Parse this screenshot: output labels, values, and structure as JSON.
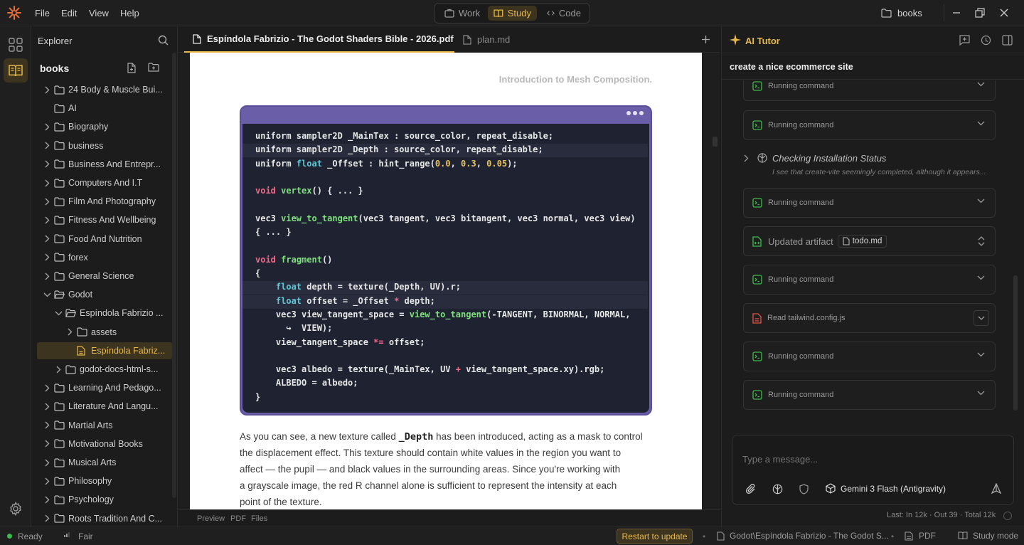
{
  "menu": [
    "File",
    "Edit",
    "View",
    "Help"
  ],
  "modes": [
    {
      "label": "Work",
      "icon": "briefcase-icon",
      "active": false
    },
    {
      "label": "Study",
      "icon": "book-open-icon",
      "active": true
    },
    {
      "label": "Code",
      "icon": "code-icon",
      "active": false
    }
  ],
  "workspace": "books",
  "explorer": {
    "title": "Explorer",
    "root": "books",
    "items": [
      {
        "label": "24 Body & Muscle Bui...",
        "depth": 0,
        "chevron": "right"
      },
      {
        "label": "AI",
        "depth": 0,
        "chevron": "none"
      },
      {
        "label": "Biography",
        "depth": 0,
        "chevron": "right"
      },
      {
        "label": "business",
        "depth": 0,
        "chevron": "right"
      },
      {
        "label": "Business And Entrepr...",
        "depth": 0,
        "chevron": "right"
      },
      {
        "label": "Computers And I.T",
        "depth": 0,
        "chevron": "right"
      },
      {
        "label": "Film And Photography",
        "depth": 0,
        "chevron": "right"
      },
      {
        "label": "Fitness And Wellbeing",
        "depth": 0,
        "chevron": "right"
      },
      {
        "label": "Food And Nutrition",
        "depth": 0,
        "chevron": "right"
      },
      {
        "label": "forex",
        "depth": 0,
        "chevron": "right"
      },
      {
        "label": "General Science",
        "depth": 0,
        "chevron": "right"
      },
      {
        "label": "Godot",
        "depth": 0,
        "chevron": "down"
      },
      {
        "label": "Espíndola Fabrizio ...",
        "depth": 1,
        "chevron": "down"
      },
      {
        "label": "assets",
        "depth": 2,
        "chevron": "right"
      },
      {
        "label": "Espíndola Fabriz...",
        "depth": 2,
        "chevron": "none",
        "file": true,
        "selected": true
      },
      {
        "label": "godot-docs-html-s...",
        "depth": 1,
        "chevron": "right"
      },
      {
        "label": "Learning And Pedago...",
        "depth": 0,
        "chevron": "right"
      },
      {
        "label": "Literature And Langu...",
        "depth": 0,
        "chevron": "right"
      },
      {
        "label": "Martial Arts",
        "depth": 0,
        "chevron": "right"
      },
      {
        "label": "Motivational Books",
        "depth": 0,
        "chevron": "right"
      },
      {
        "label": "Musical Arts",
        "depth": 0,
        "chevron": "right"
      },
      {
        "label": "Philosophy",
        "depth": 0,
        "chevron": "right"
      },
      {
        "label": "Psychology",
        "depth": 0,
        "chevron": "right"
      },
      {
        "label": "Roots Tradition And C...",
        "depth": 0,
        "chevron": "right"
      }
    ]
  },
  "tabs": [
    {
      "label": "Espíndola Fabrizio - The Godot Shaders Bible - 2026.pdf",
      "active": true
    },
    {
      "label": "plan.md",
      "active": false
    }
  ],
  "pdf": {
    "heading": "Introduction to Mesh Composition.",
    "code_lines": [
      {
        "text": "uniform sampler2D _MainTex : source_color, repeat_disable;",
        "hl": false
      },
      {
        "text": "uniform sampler2D _Depth : source_color, repeat_disable;",
        "hl": true
      },
      {
        "text": "uniform float _Offset : hint_range(0.0, 0.3, 0.05);",
        "hl": false
      },
      {
        "text": "",
        "hl": false
      },
      {
        "text": "void vertex() { ... }",
        "hl": false
      },
      {
        "text": "",
        "hl": false
      },
      {
        "text": "vec3 view_to_tangent(vec3 tangent, vec3 bitangent, vec3 normal, vec3 view)",
        "hl": false
      },
      {
        "text": "{ ... }",
        "hl": false
      },
      {
        "text": "",
        "hl": false
      },
      {
        "text": "void fragment()",
        "hl": false
      },
      {
        "text": "{",
        "hl": false
      },
      {
        "text": "    float depth = texture(_Depth, UV).r;",
        "hl": true
      },
      {
        "text": "    float offset = _Offset * depth;",
        "hl": true
      },
      {
        "text": "    vec3 view_tangent_space = view_to_tangent(-TANGENT, BINORMAL, NORMAL,",
        "hl": false
      },
      {
        "text": "      ↪  VIEW);",
        "hl": false
      },
      {
        "text": "    view_tangent_space *= offset;",
        "hl": false
      },
      {
        "text": "",
        "hl": false
      },
      {
        "text": "    vec3 albedo = texture(_MainTex, UV + view_tangent_space.xy).rgb;",
        "hl": false
      },
      {
        "text": "    ALBEDO = albedo;",
        "hl": false
      },
      {
        "text": "}",
        "hl": false
      }
    ],
    "prose_lines": [
      "As you can see, a new texture called _Depth has been introduced, acting as a mask to control",
      "the displacement effect. This texture should contain white values in the region you want to",
      "affect — the pupil — and black values in the surrounding areas. Since you're working with",
      "a grayscale image, the red R channel alone is sufficient to represent the intensity at each",
      "point of the texture."
    ]
  },
  "editor_footer": [
    "Preview",
    "PDF",
    "Files"
  ],
  "tutor": {
    "title": "AI Tutor",
    "prompt": "create a nice ecommerce site",
    "thinking_title": "Checking Installation Status",
    "thinking_sub": "I see that create-vite seemingly completed, although it appears...",
    "running_label": "Running command",
    "artifact_label": "Updated artifact",
    "artifact_file": "todo.md",
    "read_label": "Read tailwind.config.js",
    "input_placeholder": "Type a message...",
    "model": "Gemini 3 Flash (Antigravity)",
    "usage": "Last: In 12k · Out 39 · Total 12k"
  },
  "status": {
    "ready": "Ready",
    "signal": "Fair",
    "restart": "Restart to update",
    "path": "Godot\\Espíndola Fabrizio - The Godot S...",
    "format": "PDF",
    "mode": "Study mode"
  },
  "colors": {
    "accent": "#e8b84a",
    "accent_bg": "#3d3420",
    "code_frame": "#6b5ea8",
    "ready_dot": "#3fb950"
  }
}
